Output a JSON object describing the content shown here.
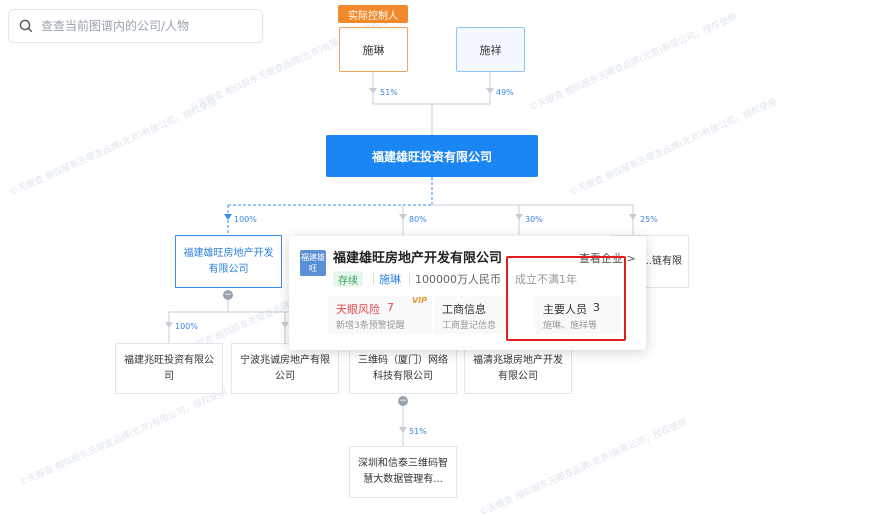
{
  "search": {
    "placeholder": "查查当前图谱内的公司/人物"
  },
  "watermark": {
    "text": "©天眼查 相似股东天眼查品牌(北京)有限公司，授权使用"
  },
  "controller_tag": "实际控制人",
  "shareholders": [
    {
      "name": "施琳",
      "percent": "51%"
    },
    {
      "name": "施祥",
      "percent": "49%"
    }
  ],
  "main_company": "福建雄旺投资有限公司",
  "level1": [
    {
      "name": "福建雄旺房地产开发有限公司",
      "percent": "100%"
    },
    {
      "name": "",
      "percent": "80%"
    },
    {
      "name": "",
      "percent": "30%"
    },
    {
      "name": "...链有限",
      "percent": "25%"
    }
  ],
  "level2": [
    {
      "name": "福建兆旺投资有限公司",
      "percent": "100%"
    },
    {
      "name": "宁波兆诚房地产有限公司",
      "percent": ""
    },
    {
      "name": "三维码（厦门）网络科技有限公司",
      "percent": ""
    },
    {
      "name": "福清兆璟房地产开发有限公司",
      "percent": ""
    }
  ],
  "level3": [
    {
      "name": "深圳和信泰三维码智慧大数据管理有...",
      "percent": "51%"
    }
  ],
  "popup": {
    "logo_text": "福建雄旺",
    "company": "福建雄旺房地产开发有限公司",
    "view_link": "查看企业 >",
    "status": "存续",
    "legal_rep": "施琳",
    "capital": "100000万人民币",
    "age": "成立不满1年",
    "risk": {
      "title": "天眼风险",
      "count": "7",
      "vip": "VIP",
      "sub": "新增3条预警提醒"
    },
    "business": {
      "title": "工商信息",
      "sub": "工商登记信息"
    },
    "staff": {
      "title": "主要人员",
      "count": "3",
      "sub": "施琳、施祥等"
    }
  },
  "colors": {
    "primary": "#1b85f3",
    "controller": "#f28a2c",
    "highlight": "#e21f1f",
    "risk": "#e84a4a"
  }
}
